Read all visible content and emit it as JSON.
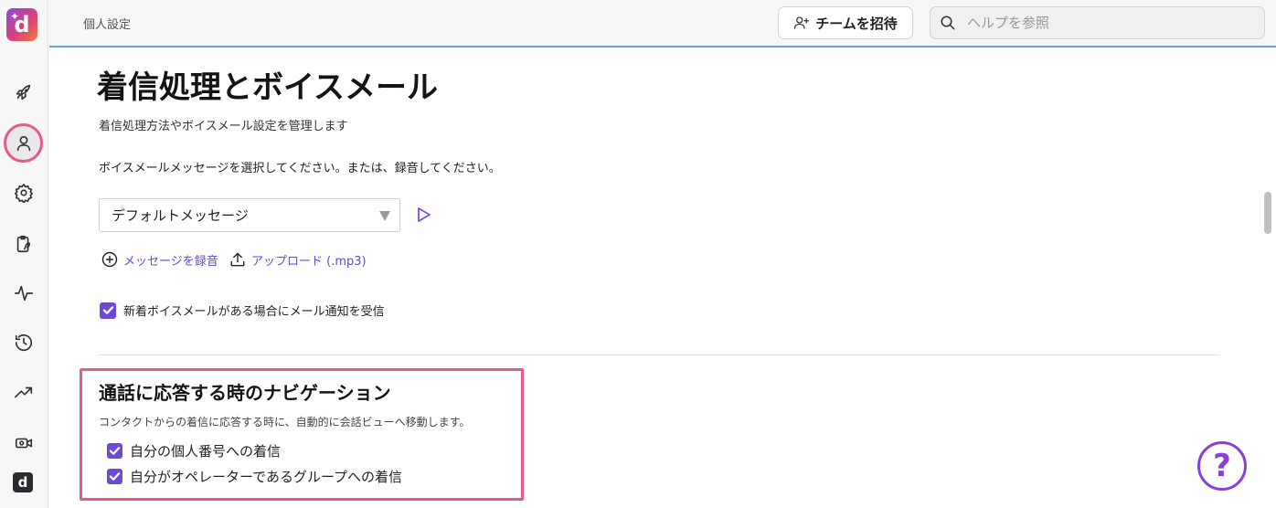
{
  "sidebar": {
    "logo_letter": "d",
    "items": [
      {
        "icon": "rocket-icon"
      },
      {
        "icon": "user-icon",
        "active": true
      },
      {
        "icon": "gear-icon"
      },
      {
        "icon": "clipboard-icon"
      },
      {
        "icon": "activity-icon"
      },
      {
        "icon": "history-icon"
      },
      {
        "icon": "trending-icon"
      },
      {
        "icon": "video-settings-icon"
      }
    ],
    "bottom_logo_letter": "d"
  },
  "topbar": {
    "breadcrumb": "個人設定",
    "invite_label": "チームを招待",
    "search_placeholder": "ヘルプを参照"
  },
  "main": {
    "title": "着信処理とボイスメール",
    "subtitle": "着信処理方法やボイスメール設定を管理します",
    "voicemail_prompt": "ボイスメールメッセージを選択してください。または、録音してください。",
    "voicemail_select_value": "デフォルトメッセージ",
    "record_link": "メッセージを録音",
    "upload_link": "アップロード (.mp3)",
    "email_notify_label": "新着ボイスメールがある場合にメール通知を受信",
    "email_notify_checked": true,
    "nav_section": {
      "title": "通話に応答する時のナビゲーション",
      "description": "コンタクトからの着信に応答する時に、自動的に会話ビューへ移動します。",
      "options": [
        {
          "label": "自分の個人番号への着信",
          "checked": true
        },
        {
          "label": "自分がオペレーターであるグループへの着信",
          "checked": true
        }
      ]
    }
  },
  "help_fab": "?",
  "colors": {
    "accent": "#6e49d8",
    "highlight": "#e8598d",
    "topbar_border": "#5aa7e6"
  }
}
